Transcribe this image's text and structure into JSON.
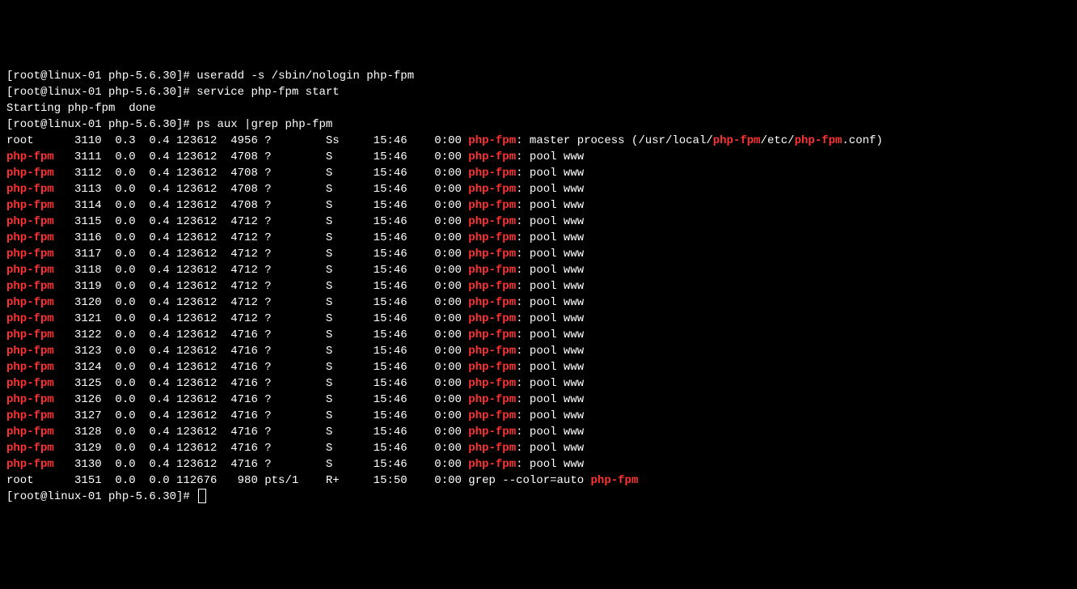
{
  "prompt": "[root@linux-01 php-5.6.30]#",
  "cmds": {
    "useradd": "useradd -s /sbin/nologin php-fpm",
    "service": "service php-fpm start",
    "startmsg": "Starting php-fpm  done",
    "ps": "ps aux |grep php-fpm"
  },
  "master": {
    "user": "root",
    "pid": "3110",
    "cpu": "0.3",
    "mem": "0.4",
    "vsz": "123612",
    "rss": "4956",
    "tty": "?",
    "stat": "Ss",
    "start": "15:46",
    "time": "0:00",
    "cmd_pre": "",
    "cmd_hl1": "php-fpm",
    "cmd_mid1": ": master process (/usr/local/",
    "cmd_hl2": "php-fpm",
    "cmd_mid2": "/etc/",
    "cmd_hl3": "php-fpm",
    "cmd_post": ".conf)"
  },
  "workers": [
    {
      "pid": "3111",
      "rss": "4708"
    },
    {
      "pid": "3112",
      "rss": "4708"
    },
    {
      "pid": "3113",
      "rss": "4708"
    },
    {
      "pid": "3114",
      "rss": "4708"
    },
    {
      "pid": "3115",
      "rss": "4712"
    },
    {
      "pid": "3116",
      "rss": "4712"
    },
    {
      "pid": "3117",
      "rss": "4712"
    },
    {
      "pid": "3118",
      "rss": "4712"
    },
    {
      "pid": "3119",
      "rss": "4712"
    },
    {
      "pid": "3120",
      "rss": "4712"
    },
    {
      "pid": "3121",
      "rss": "4712"
    },
    {
      "pid": "3122",
      "rss": "4716"
    },
    {
      "pid": "3123",
      "rss": "4716"
    },
    {
      "pid": "3124",
      "rss": "4716"
    },
    {
      "pid": "3125",
      "rss": "4716"
    },
    {
      "pid": "3126",
      "rss": "4716"
    },
    {
      "pid": "3127",
      "rss": "4716"
    },
    {
      "pid": "3128",
      "rss": "4716"
    },
    {
      "pid": "3129",
      "rss": "4716"
    },
    {
      "pid": "3130",
      "rss": "4716"
    }
  ],
  "worker_common": {
    "user": "php-fpm",
    "cpu": "0.0",
    "mem": "0.4",
    "vsz": "123612",
    "tty": "?",
    "stat": "S",
    "start": "15:46",
    "time": "0:00",
    "cmd_hl": "php-fpm",
    "cmd_post": ": pool www"
  },
  "grep": {
    "user": "root",
    "pid": "3151",
    "cpu": "0.0",
    "mem": "0.0",
    "vsz": "112676",
    "rss": "980",
    "tty": "pts/1",
    "stat": "R+",
    "start": "15:50",
    "time": "0:00",
    "cmd_pre": "grep --color=auto ",
    "cmd_hl": "php-fpm"
  }
}
